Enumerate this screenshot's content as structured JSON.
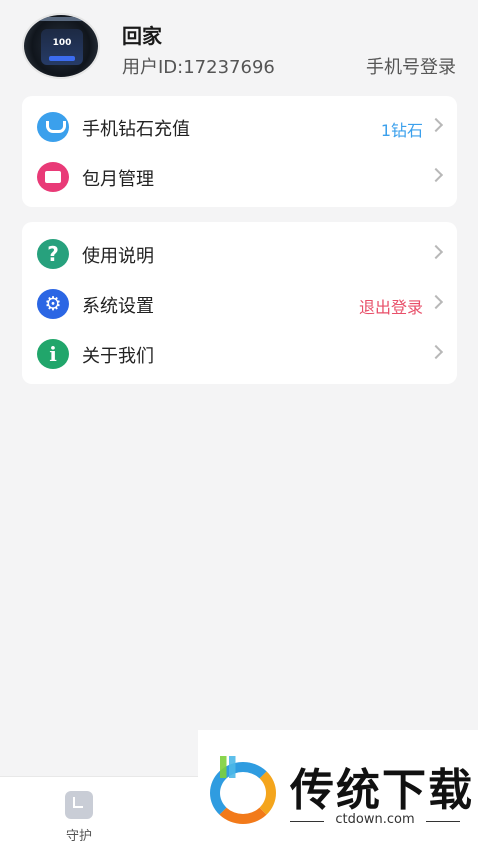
{
  "profile": {
    "username": "回家",
    "user_id": "用户ID:17237696",
    "phone_login": "手机号登录",
    "avatar_screen_text": "100"
  },
  "card1": {
    "items": [
      {
        "label": "手机钻石充值",
        "value": "1钻石",
        "value_color": "#3ba0ec",
        "icon": "diamond-icon"
      },
      {
        "label": "包月管理",
        "value": "",
        "icon": "wallet-icon"
      }
    ]
  },
  "card2": {
    "items": [
      {
        "label": "使用说明",
        "value": "",
        "icon": "help-icon",
        "glyph": "?"
      },
      {
        "label": "系统设置",
        "value": "退出登录",
        "value_color": "#e8506a",
        "icon": "gear-icon",
        "glyph": "⚙"
      },
      {
        "label": "关于我们",
        "value": "",
        "icon": "info-icon",
        "glyph": "i"
      }
    ]
  },
  "bottom_nav": {
    "items": [
      {
        "label": "守护",
        "icon": "watch-clock-icon"
      }
    ]
  },
  "watermark": {
    "title": "传统下载",
    "subtitle": "ctdown.com"
  }
}
